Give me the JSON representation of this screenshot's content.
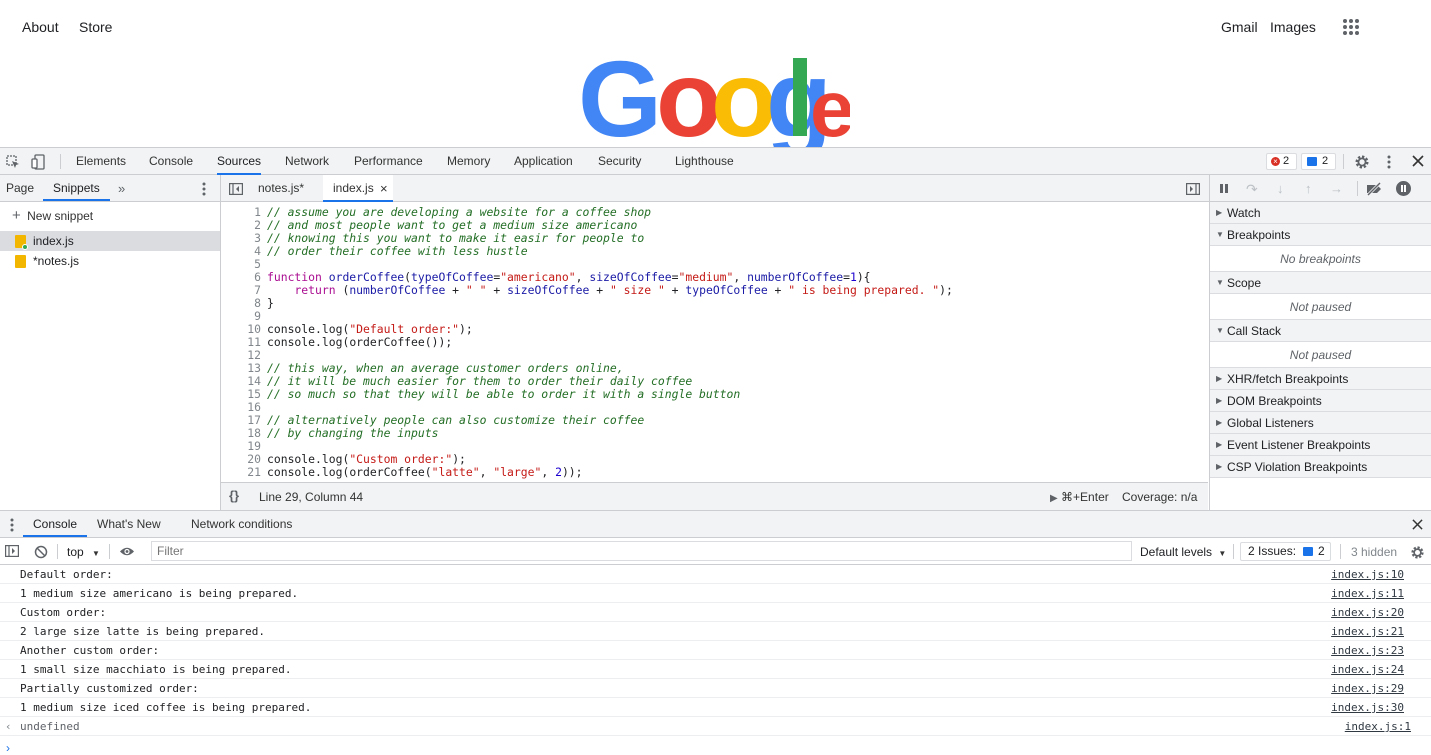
{
  "google": {
    "links_left": [
      "About",
      "Store"
    ],
    "links_right": [
      "Gmail",
      "Images"
    ],
    "logo_letters": [
      "G",
      "o",
      "o",
      "g",
      "l",
      "e"
    ]
  },
  "devtools": {
    "main_tabs": [
      "Elements",
      "Console",
      "Sources",
      "Network",
      "Performance",
      "Memory",
      "Application",
      "Security",
      "Lighthouse"
    ],
    "active_tab": "Sources",
    "error_count": "2",
    "message_count": "2",
    "navigator": {
      "tabs": [
        "Page",
        "Snippets"
      ],
      "new_snippet": "New snippet",
      "files": [
        "index.js",
        "*notes.js"
      ]
    },
    "editor": {
      "tabs": [
        "notes.js*",
        "index.js"
      ],
      "status_position": "Line 29, Column 44",
      "run_hint": "⌘+Enter",
      "coverage": "Coverage: n/a",
      "lines": [
        {
          "n": "1",
          "t": "// assume you are developing a website for a coffee shop"
        },
        {
          "n": "2",
          "t": "// and most people want to get a medium size americano"
        },
        {
          "n": "3",
          "t": "// knowing this you want to make it easir for people to"
        },
        {
          "n": "4",
          "t": "// order their coffee with less hustle"
        },
        {
          "n": "5",
          "t": ""
        },
        {
          "n": "6",
          "t": "function orderCoffee(typeOfCoffee=\"americano\", sizeOfCoffee=\"medium\", numberOfCoffee=1){"
        },
        {
          "n": "7",
          "t": "    return (numberOfCoffee + \" \" + sizeOfCoffee + \" size \" + typeOfCoffee + \" is being prepared. \");"
        },
        {
          "n": "8",
          "t": "}"
        },
        {
          "n": "9",
          "t": ""
        },
        {
          "n": "10",
          "t": "console.log(\"Default order:\");"
        },
        {
          "n": "11",
          "t": "console.log(orderCoffee());"
        },
        {
          "n": "12",
          "t": ""
        },
        {
          "n": "13",
          "t": "// this way, when an average customer orders online,"
        },
        {
          "n": "14",
          "t": "// it will be much easier for them to order their daily coffee"
        },
        {
          "n": "15",
          "t": "// so much so that they will be able to order it with a single button"
        },
        {
          "n": "16",
          "t": ""
        },
        {
          "n": "17",
          "t": "// alternatively people can also customize their coffee"
        },
        {
          "n": "18",
          "t": "// by changing the inputs"
        },
        {
          "n": "19",
          "t": ""
        },
        {
          "n": "20",
          "t": "console.log(\"Custom order:\");"
        },
        {
          "n": "21",
          "t": "console.log(orderCoffee(\"latte\", \"large\", 2));"
        }
      ]
    },
    "debugger": {
      "sections": [
        {
          "label": "Watch",
          "open": false,
          "empty": ""
        },
        {
          "label": "Breakpoints",
          "open": true,
          "empty": "No breakpoints"
        },
        {
          "label": "Scope",
          "open": true,
          "empty": "Not paused"
        },
        {
          "label": "Call Stack",
          "open": true,
          "empty": "Not paused"
        },
        {
          "label": "XHR/fetch Breakpoints",
          "open": false,
          "empty": ""
        },
        {
          "label": "DOM Breakpoints",
          "open": false,
          "empty": ""
        },
        {
          "label": "Global Listeners",
          "open": false,
          "empty": ""
        },
        {
          "label": "Event Listener Breakpoints",
          "open": false,
          "empty": ""
        },
        {
          "label": "CSP Violation Breakpoints",
          "open": false,
          "empty": ""
        }
      ]
    },
    "drawer": {
      "tabs": [
        "Console",
        "What's New",
        "Network conditions"
      ],
      "context": "top",
      "filter_placeholder": "Filter",
      "levels": "Default levels",
      "issues_label": "2 Issues:",
      "issues_count": "2",
      "hidden": "3 hidden",
      "messages": [
        {
          "text": "Default order:",
          "src": "index.js:10"
        },
        {
          "text": "1 medium size americano is being prepared. ",
          "src": "index.js:11"
        },
        {
          "text": "Custom order:",
          "src": "index.js:20"
        },
        {
          "text": "2 large size latte is being prepared. ",
          "src": "index.js:21"
        },
        {
          "text": "Another custom order:",
          "src": "index.js:23"
        },
        {
          "text": "1 small size macchiato is being prepared. ",
          "src": "index.js:24"
        },
        {
          "text": "Partially customized order:",
          "src": "index.js:29"
        },
        {
          "text": "1 medium size iced coffee is being prepared. ",
          "src": "index.js:30"
        },
        {
          "text": "undefined",
          "src": "index.js:1"
        }
      ]
    }
  },
  "colors": {
    "accent": "#1a73e8",
    "google_blue": "#4285F4",
    "google_red": "#EA4335",
    "google_yellow": "#FBBC05",
    "google_green": "#34A853"
  }
}
